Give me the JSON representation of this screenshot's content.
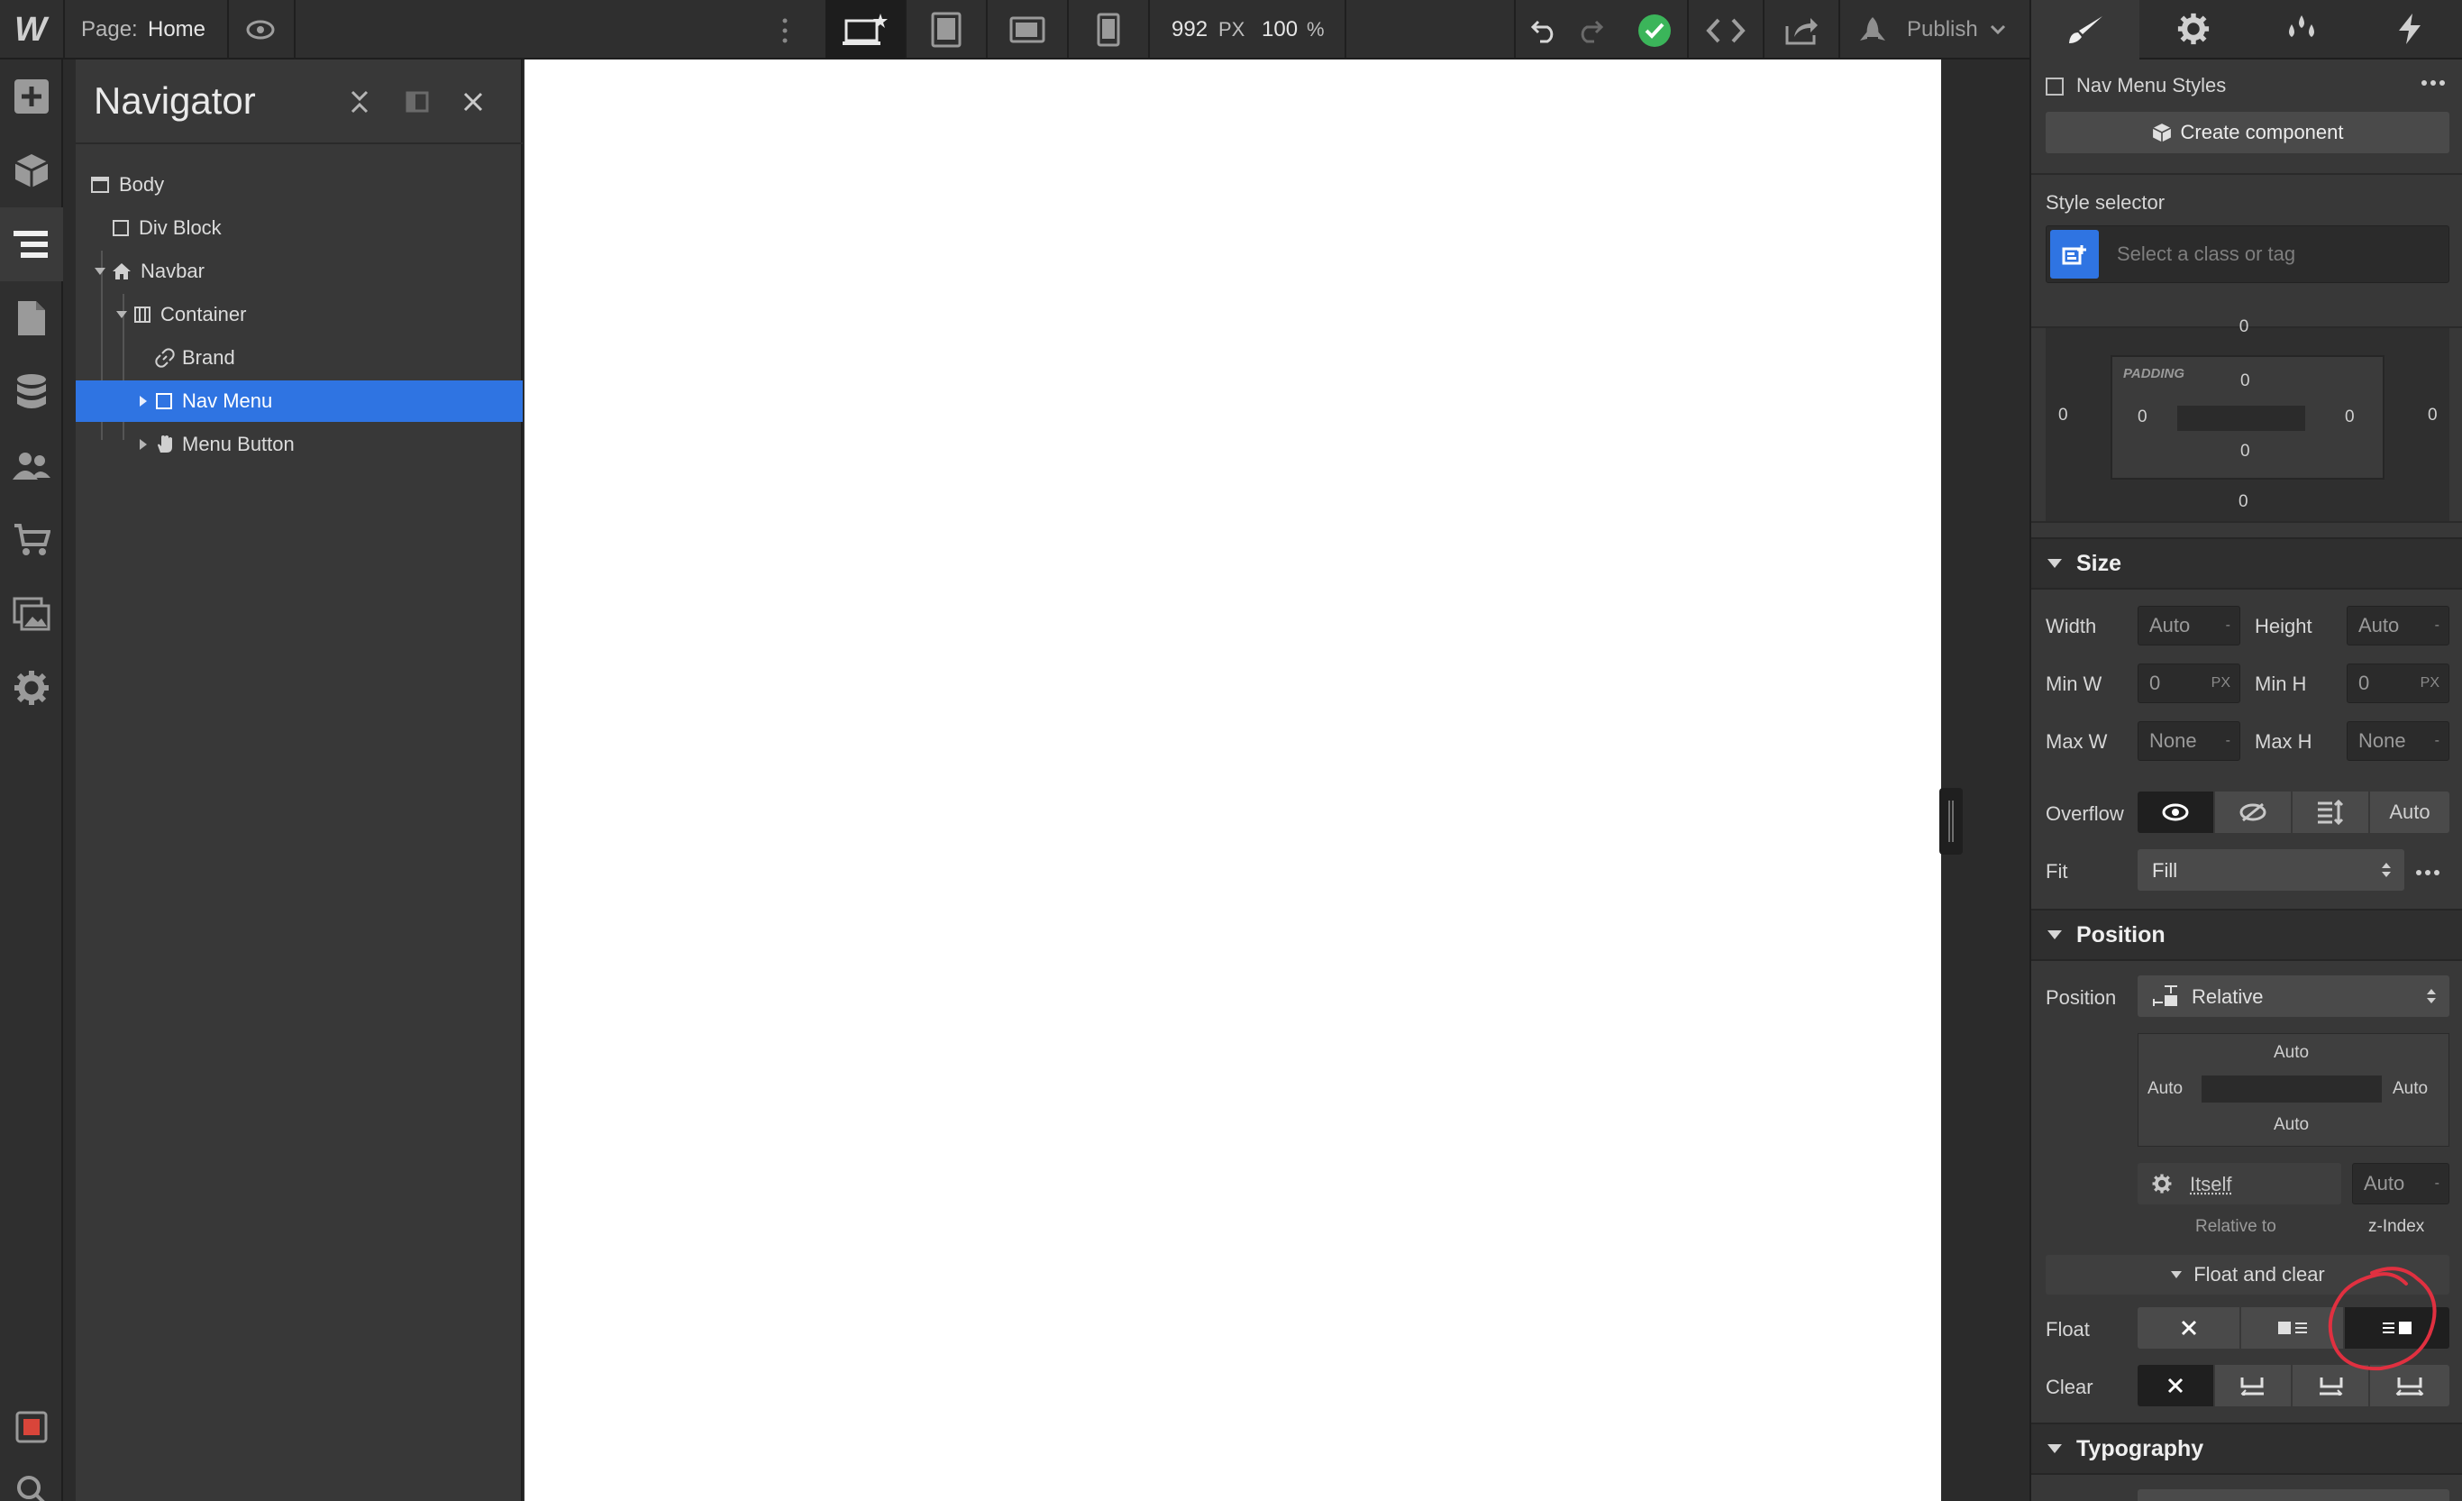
{
  "topbar": {
    "logo": "W",
    "page_label": "Page:",
    "page_name": "Home",
    "width_value": "992",
    "width_unit": "PX",
    "zoom_value": "100",
    "zoom_unit": "%",
    "publish_label": "Publish"
  },
  "navigator": {
    "title": "Navigator",
    "items": [
      {
        "label": "Body",
        "icon": "body-icon"
      },
      {
        "label": "Div Block",
        "icon": "div-block-icon"
      },
      {
        "label": "Navbar",
        "icon": "navbar-home-icon"
      },
      {
        "label": "Container",
        "icon": "container-icon"
      },
      {
        "label": "Brand",
        "icon": "link-icon"
      },
      {
        "label": "Nav Menu",
        "icon": "div-block-icon",
        "selected": true
      },
      {
        "label": "Menu Button",
        "icon": "hand-icon"
      }
    ]
  },
  "rpanel": {
    "element_name": "Nav Menu Styles",
    "create_component": "Create component",
    "style_selector_label": "Style selector",
    "style_selector_placeholder": "Select a class or tag",
    "spacing": {
      "padding_label": "PADDING",
      "margin_left": "0",
      "margin_right": "0",
      "margin_bottom": "0",
      "padding_top": "0",
      "padding_left": "0",
      "padding_right": "0",
      "padding_bottom": "0"
    },
    "size": {
      "title": "Size",
      "width_label": "Width",
      "width_value": "Auto",
      "width_unit": "-",
      "height_label": "Height",
      "height_value": "Auto",
      "height_unit": "-",
      "minw_label": "Min W",
      "minw_value": "0",
      "minw_unit": "PX",
      "minh_label": "Min H",
      "minh_value": "0",
      "minh_unit": "PX",
      "maxw_label": "Max W",
      "maxw_value": "None",
      "maxw_unit": "-",
      "maxh_label": "Max H",
      "maxh_value": "None",
      "maxh_unit": "-",
      "overflow_label": "Overflow",
      "overflow_auto": "Auto",
      "fit_label": "Fit",
      "fit_value": "Fill"
    },
    "position": {
      "title": "Position",
      "position_label": "Position",
      "position_value": "Relative",
      "top": "Auto",
      "left": "Auto",
      "right": "Auto",
      "bottom": "Auto",
      "relative_value": "Itself",
      "relative_label": "Relative to",
      "zindex_value": "Auto",
      "zindex_unit": "-",
      "zindex_label": "z-Index",
      "float_clear_label": "Float and clear",
      "float_label": "Float",
      "clear_label": "Clear"
    },
    "typography_title": "Typography"
  },
  "colors": {
    "accent": "#2f74e2",
    "success": "#3bb55a",
    "annotation": "#e03040"
  }
}
